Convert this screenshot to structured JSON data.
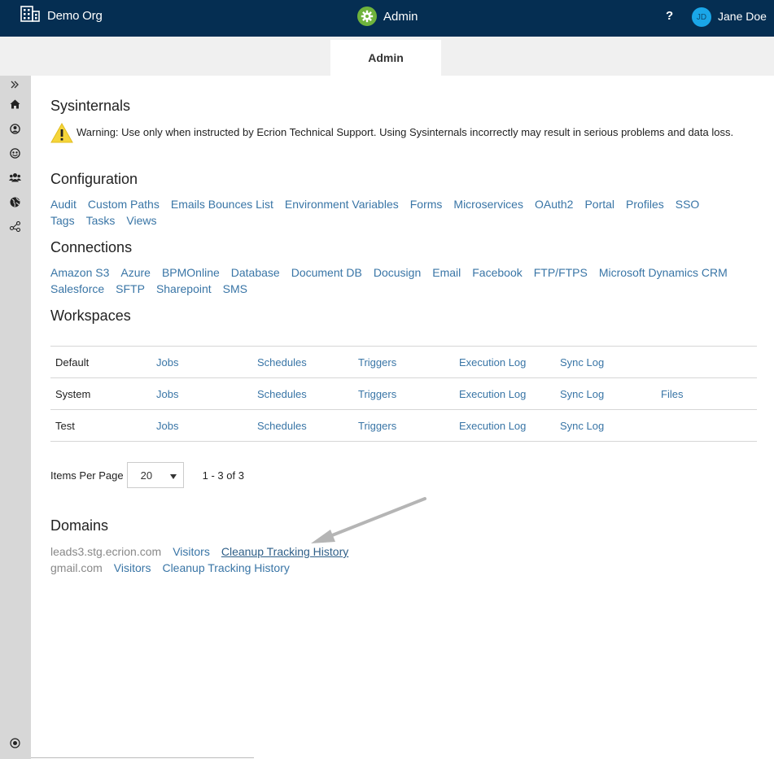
{
  "header": {
    "org": "Demo Org",
    "app": "Admin",
    "help": "?",
    "avatar_initials": "JD",
    "user_name": "Jane Doe",
    "colors": {
      "bar": "#052e52",
      "app_icon": "#6fb33c",
      "avatar": "#1aa6e8"
    }
  },
  "tabs": [
    {
      "label": "Admin",
      "active": true
    }
  ],
  "sidebar": {
    "icons": [
      "expand-icon",
      "home-icon",
      "user-icon",
      "support-icon",
      "users-icon",
      "globe-icon",
      "share-icon",
      "settings-dot-icon"
    ]
  },
  "sysinternals": {
    "title": "Sysinternals",
    "warning": "Warning: Use only when instructed by Ecrion Technical Support. Using Sysinternals incorrectly may result in serious problems and data loss."
  },
  "configuration": {
    "title": "Configuration",
    "links": [
      "Audit",
      "Custom Paths",
      "Emails Bounces List",
      "Environment Variables",
      "Forms",
      "Microservices",
      "OAuth2",
      "Portal",
      "Profiles",
      "SSO",
      "Tags",
      "Tasks",
      "Views"
    ]
  },
  "connections": {
    "title": "Connections",
    "links": [
      "Amazon S3",
      "Azure",
      "BPMOnline",
      "Database",
      "Document DB",
      "Docusign",
      "Email",
      "Facebook",
      "FTP/FTPS",
      "Microsoft Dynamics CRM",
      "Salesforce",
      "SFTP",
      "Sharepoint",
      "SMS"
    ]
  },
  "workspaces": {
    "title": "Workspaces",
    "rows": [
      {
        "name": "Default",
        "jobs": "Jobs",
        "schedules": "Schedules",
        "triggers": "Triggers",
        "execution_log": "Execution Log",
        "sync_log": "Sync Log",
        "files": ""
      },
      {
        "name": "System",
        "jobs": "Jobs",
        "schedules": "Schedules",
        "triggers": "Triggers",
        "execution_log": "Execution Log",
        "sync_log": "Sync Log",
        "files": "Files"
      },
      {
        "name": "Test",
        "jobs": "Jobs",
        "schedules": "Schedules",
        "triggers": "Triggers",
        "execution_log": "Execution Log",
        "sync_log": "Sync Log",
        "files": ""
      }
    ]
  },
  "pager": {
    "label": "Items Per Page",
    "per_page": "20",
    "range": "1 - 3 of 3"
  },
  "domains": {
    "title": "Domains",
    "rows": [
      {
        "name": "leads3.stg.ecrion.com",
        "visitors": "Visitors",
        "cleanup": "Cleanup Tracking History"
      },
      {
        "name": "gmail.com",
        "visitors": "Visitors",
        "cleanup": "Cleanup Tracking History"
      }
    ]
  }
}
